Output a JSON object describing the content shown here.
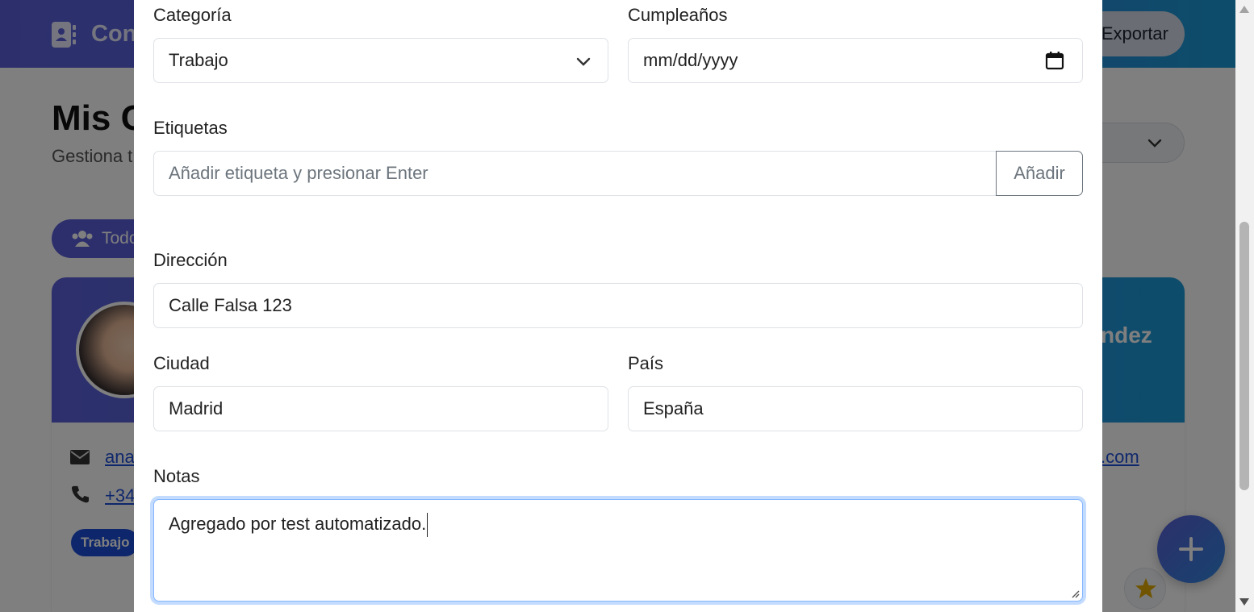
{
  "background": {
    "brand": "Con",
    "export_label": "Exportar",
    "title": "Mis C",
    "subtitle": "Gestiona t",
    "filter_pill": "Todo",
    "card_name_tail": "ndez",
    "email_head": "ana",
    "email_tail": ".com",
    "phone_head": "+34",
    "tag": "Trabajo"
  },
  "form": {
    "category": {
      "label": "Categoría",
      "value": "Trabajo"
    },
    "birthday": {
      "label": "Cumpleaños",
      "placeholder": "mm/dd/yyyy"
    },
    "tags": {
      "label": "Etiquetas",
      "placeholder": "Añadir etiqueta y presionar Enter",
      "button": "Añadir"
    },
    "address": {
      "label": "Dirección",
      "value": "Calle Falsa 123"
    },
    "city": {
      "label": "Ciudad",
      "value": "Madrid"
    },
    "country": {
      "label": "País",
      "value": "España"
    },
    "notes": {
      "label": "Notas",
      "value": "Agregado por test automatizado."
    }
  },
  "icons": {
    "brand": "address-book-icon",
    "category_select": "chevron-down-icon",
    "birthday": "calendar-icon",
    "email": "envelope-icon",
    "phone": "phone-icon",
    "filter": "users-icon",
    "fab": "plus-icon",
    "favorite": "star-icon"
  },
  "colors": {
    "brand_gradient_start": "#5b5fd8",
    "brand_gradient_end": "#1a9ad6",
    "focus_ring": "#86b7fe",
    "tag_bg": "#1d4ed8",
    "star": "#e0a800"
  }
}
